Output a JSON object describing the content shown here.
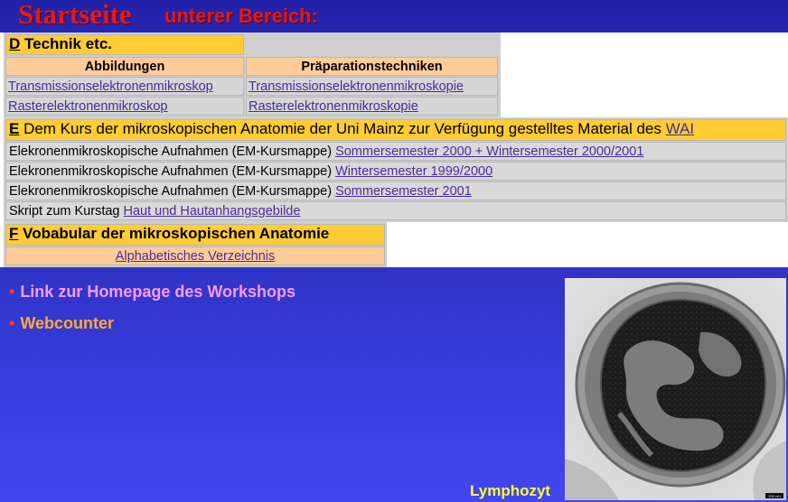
{
  "title": {
    "main": "Startseite",
    "sub": "unterer Bereich:"
  },
  "section_d": {
    "letter": "D",
    "title": " Technik etc.",
    "col1": "Abbildungen",
    "col2": "Präparationstechniken",
    "rows": [
      [
        "Transmissionselektronenmikroskop",
        "Transmissionselektronenmikroskopie"
      ],
      [
        "Rasterelektronenmikroskop",
        "Rasterelektronenmikroskopie"
      ]
    ]
  },
  "section_e": {
    "letter": "E",
    "title": " Dem Kurs der mikroskopischen Anatomie der Uni Mainz zur Verfügung gestelltes Material des ",
    "wai": "WAI",
    "rows": [
      {
        "label": "Elekronenmikroskopische Aufnahmen (EM-Kursmappe) ",
        "link": "Sommersemester 2000 + Wintersemester 2000/2001"
      },
      {
        "label": "Elekronenmikroskopische Aufnahmen (EM-Kursmappe) ",
        "link": "Wintersemester 1999/2000"
      },
      {
        "label": "Elekronenmikroskopische Aufnahmen (EM-Kursmappe) ",
        "link": "Sommersemester 2001"
      },
      {
        "label": "Skript zum Kurstag ",
        "link": "Haut und Hautanhangsgebilde"
      }
    ]
  },
  "section_f": {
    "letter": "F",
    "title": " Vobabular der mikroskopischen Anatomie",
    "link": "Alphabetisches Verzeichnis"
  },
  "links": {
    "bullet": "•",
    "workshop": "Link zur Homepage des Workshops",
    "webcounter": "Webcounter",
    "workshop_color": "#ff99ff",
    "webcounter_color": "#ffaa33"
  },
  "image": {
    "caption": "Lymphozyt",
    "scale_label": "200 nm"
  }
}
